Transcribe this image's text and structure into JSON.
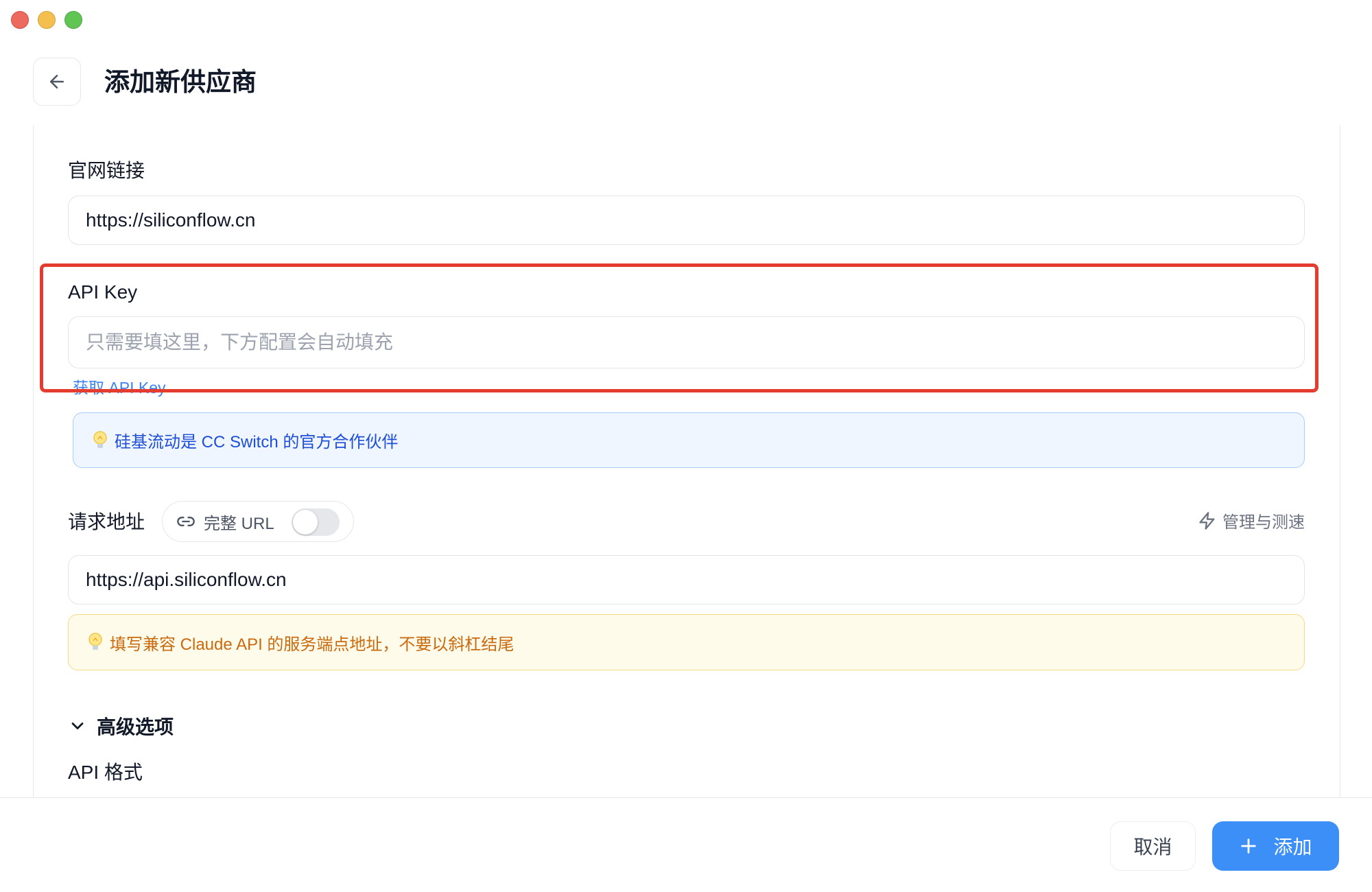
{
  "window": {
    "controls": [
      "close",
      "minimize",
      "zoom"
    ]
  },
  "header": {
    "title": "添加新供应商",
    "back_icon": "arrow-left-icon"
  },
  "form": {
    "website": {
      "label": "官网链接",
      "value": "https://siliconflow.cn"
    },
    "api_key": {
      "label": "API Key",
      "value": "",
      "placeholder": "只需要填这里，下方配置会自动填充",
      "get_key_link": "获取 API Key"
    },
    "partner_notice": {
      "icon": "lightbulb-icon",
      "text": "硅基流动是 CC Switch 的官方合作伙伴"
    },
    "request_url": {
      "label": "请求地址",
      "full_url_toggle_label": "完整 URL",
      "full_url_enabled": false,
      "link_icon": "link-icon",
      "manage_label": "管理与测速",
      "manage_icon": "lightning-icon",
      "value": "https://api.siliconflow.cn",
      "hint": "填写兼容 Claude API 的服务端点地址，不要以斜杠结尾",
      "hint_icon": "lightbulb-icon"
    },
    "advanced": {
      "label": "高级选项",
      "expanded": true,
      "api_format_label": "API 格式"
    }
  },
  "footer": {
    "cancel_label": "取消",
    "add_label": "添加",
    "add_icon": "plus-icon"
  },
  "colors": {
    "accent": "#3b8ff6",
    "highlight_border": "#e43d2f",
    "info_blue_bg": "#eff6ff",
    "info_blue_text": "#1d4ed8",
    "info_amber_bg": "#fffbeb",
    "info_amber_text": "#c96a0e"
  }
}
